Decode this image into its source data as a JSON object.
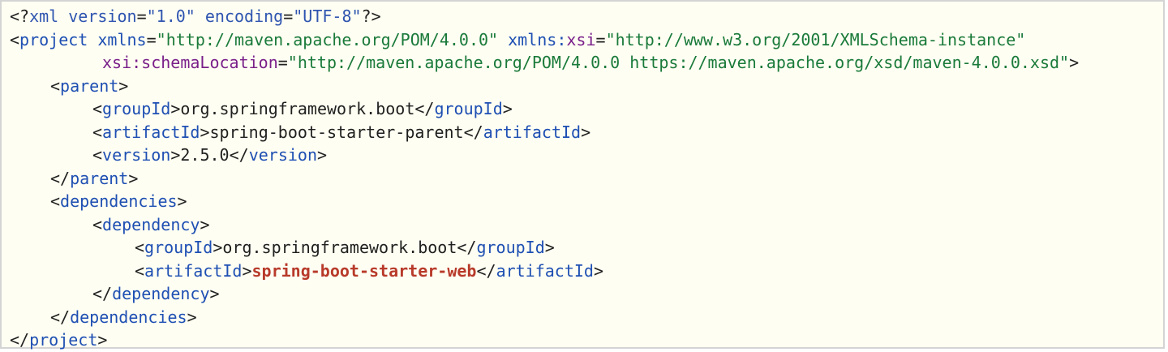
{
  "code": {
    "decl": {
      "open": "<?",
      "name": "xml",
      "attr1": "version",
      "val1": "\"1.0\"",
      "attr2": "encoding",
      "val2": "\"UTF-8\"",
      "close": "?>"
    },
    "project": {
      "tag": "project",
      "xmlns_attr": "xmlns",
      "xmlns_val": "\"http://maven.apache.org/POM/4.0.0\"",
      "xsi_prefix": "xmlns:",
      "xsi_name": "xsi",
      "xsi_val": "\"http://www.w3.org/2001/XMLSchema-instance\"",
      "schema_attr": "xsi:schemaLocation",
      "schema_val": "\"http://maven.apache.org/POM/4.0.0 https://maven.apache.org/xsd/maven-4.0.0.xsd\""
    },
    "parent": {
      "tag": "parent",
      "groupId_tag": "groupId",
      "groupId": "org.springframework.boot",
      "artifactId_tag": "artifactId",
      "artifactId": "spring-boot-starter-parent",
      "version_tag": "version",
      "version": "2.5.0"
    },
    "dependencies": {
      "tag": "dependencies",
      "dependency_tag": "dependency",
      "groupId_tag": "groupId",
      "groupId": "org.springframework.boot",
      "artifactId_tag": "artifactId",
      "artifactId": "spring-boot-starter-web"
    }
  },
  "colors": {
    "tag": "#1e4fb3",
    "attribute": "#7a1f8a",
    "value": "#1a7a3a",
    "highlight": "#b83a2a",
    "background": "#fefef2"
  }
}
